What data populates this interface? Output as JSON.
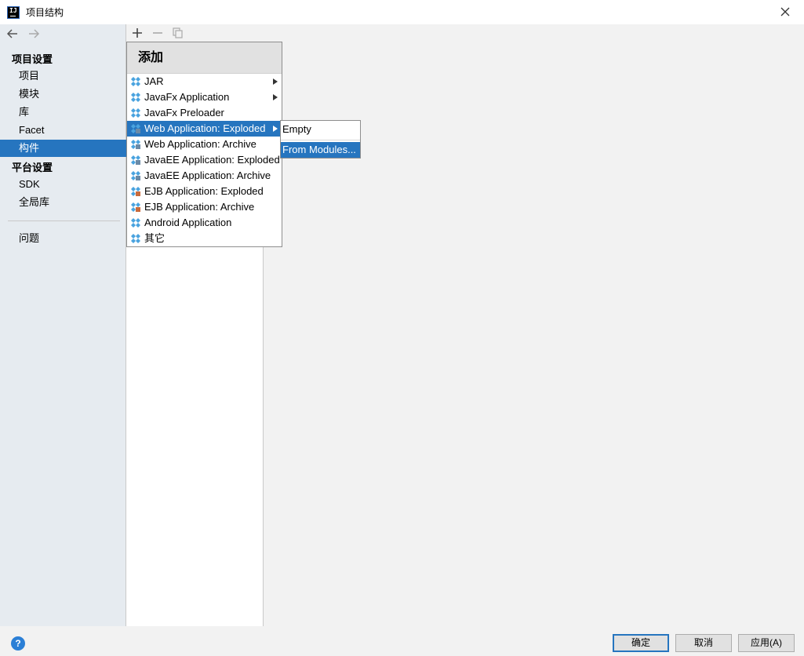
{
  "window": {
    "title": "项目结构",
    "app_icon_text": "IJ"
  },
  "sidebar": {
    "sections": [
      {
        "label": "项目设置",
        "items": [
          "项目",
          "模块",
          "库",
          "Facet",
          "构件"
        ]
      },
      {
        "label": "平台设置",
        "items": [
          "SDK",
          "全局库"
        ]
      }
    ],
    "extra_items": [
      "问题"
    ],
    "selected": "构件"
  },
  "toolbar": {
    "icons": [
      "plus-icon",
      "minus-icon",
      "copy-icon"
    ]
  },
  "add_popup": {
    "header": "添加",
    "items": [
      {
        "label": "JAR",
        "icon": "artifact-jar-icon",
        "has_submenu": true,
        "active": false
      },
      {
        "label": "JavaFx Application",
        "icon": "artifact-icon",
        "has_submenu": true,
        "active": false
      },
      {
        "label": "JavaFx Preloader",
        "icon": "artifact-icon",
        "has_submenu": false,
        "active": false
      },
      {
        "label": "Web Application: Exploded",
        "icon": "web-artifact-icon",
        "has_submenu": true,
        "active": true
      },
      {
        "label": "Web Application: Archive",
        "icon": "web-artifact-icon",
        "has_submenu": false,
        "active": false
      },
      {
        "label": "JavaEE Application: Exploded",
        "icon": "javaee-artifact-icon",
        "has_submenu": false,
        "active": false
      },
      {
        "label": "JavaEE Application: Archive",
        "icon": "javaee-artifact-icon",
        "has_submenu": false,
        "active": false
      },
      {
        "label": "EJB Application: Exploded",
        "icon": "ejb-artifact-icon",
        "has_submenu": false,
        "active": false
      },
      {
        "label": "EJB Application: Archive",
        "icon": "ejb-artifact-icon",
        "has_submenu": false,
        "active": false
      },
      {
        "label": "Android Application",
        "icon": "artifact-icon",
        "has_submenu": false,
        "active": false
      },
      {
        "label": "其它",
        "icon": "artifact-icon",
        "has_submenu": false,
        "active": false
      }
    ]
  },
  "submenu": {
    "items": [
      {
        "label": "Empty",
        "active": false
      },
      {
        "label": "From Modules...",
        "active": true
      }
    ]
  },
  "footer": {
    "help": "?",
    "ok": "确定",
    "cancel": "取消",
    "apply": "应用(A)"
  },
  "colors": {
    "selection": "#2675bf",
    "sidebar_bg": "#e6ebf0",
    "dialog_bg": "#f2f2f2",
    "artifact_icon": "#4aa3df"
  }
}
